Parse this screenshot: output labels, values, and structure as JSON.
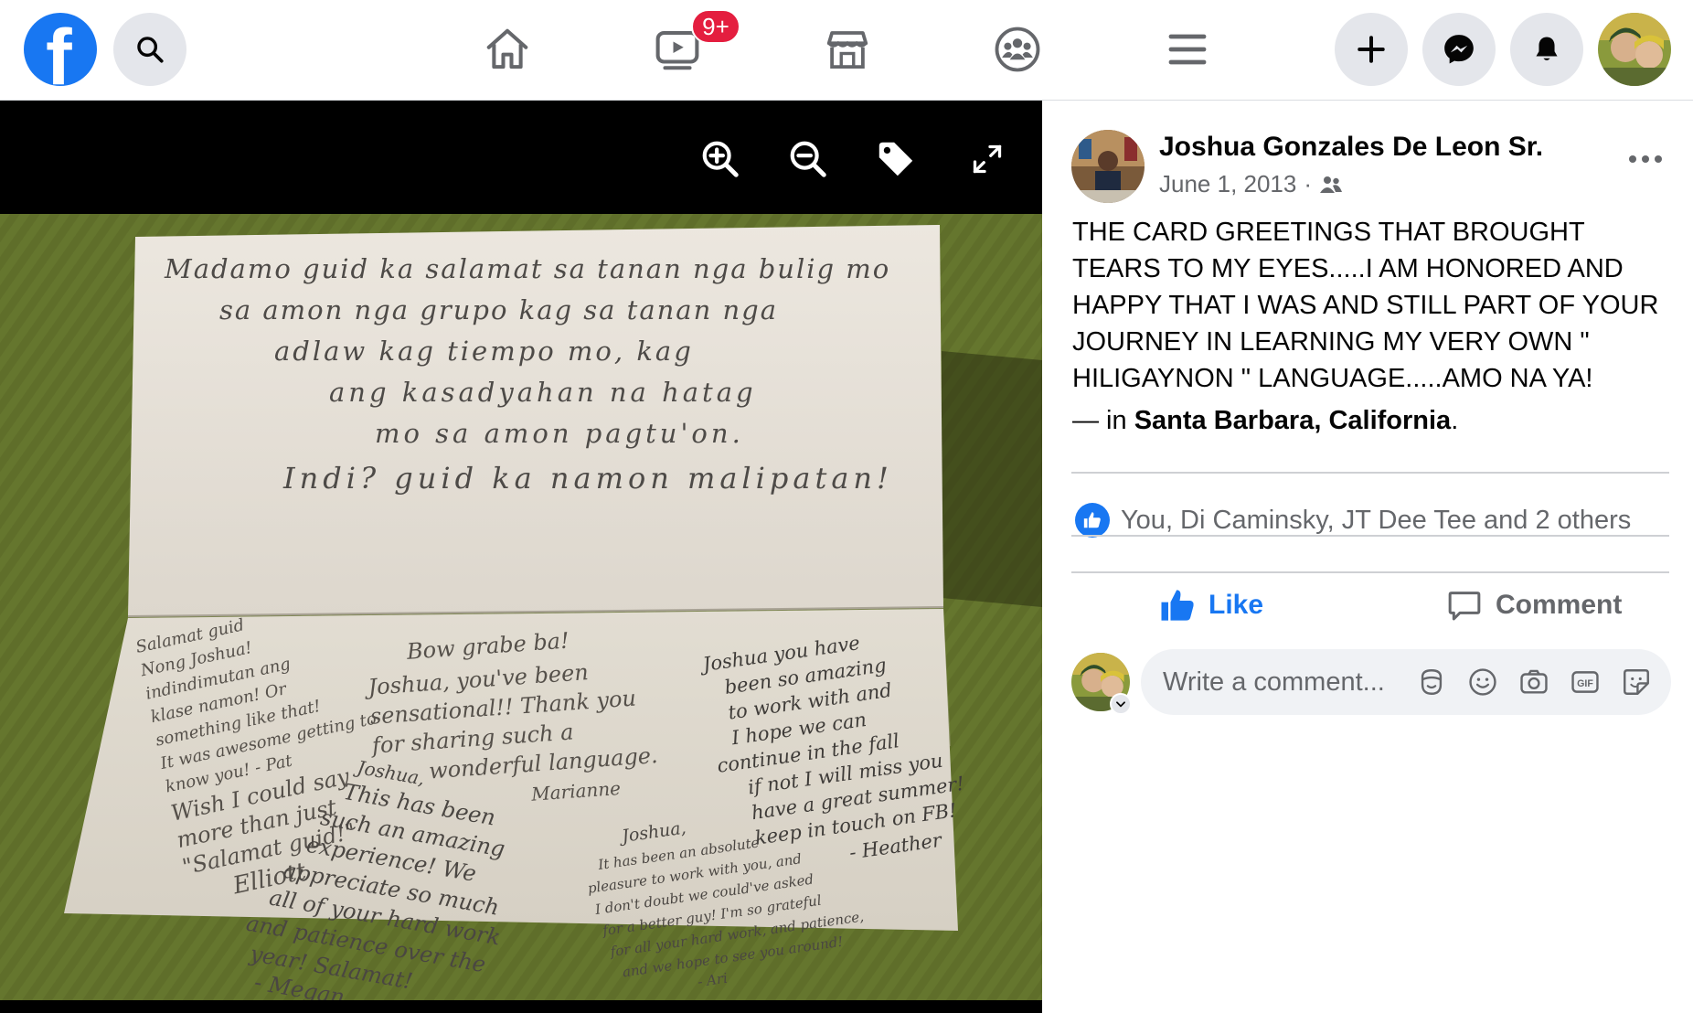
{
  "topbar": {
    "logo_letter": "f",
    "icons": {
      "search": "search-icon",
      "home": "home-icon",
      "watch": "video-icon",
      "marketplace": "store-icon",
      "groups": "groups-icon",
      "menu": "hamburger-icon",
      "create": "plus-icon",
      "messenger": "messenger-icon",
      "notifications": "bell-icon"
    },
    "watch_badge": "9+"
  },
  "photo": {
    "toolbar_icons": [
      "zoom-in-icon",
      "zoom-out-icon",
      "tag-icon",
      "fullscreen-icon"
    ],
    "card_top_lines": [
      "Madamo guid ka salamat sa tanan nga bulig mo",
      "sa amon nga grupo kag sa tanan nga",
      "adlaw kag tiempo mo, kag",
      "ang kasadyahan na hatag",
      "mo sa amon pagtu'on.",
      "Indi? guid ka namon malipatan!"
    ],
    "note_1": [
      "Salamat guid",
      "Nong Joshua!",
      "indindimutan ang",
      "klase namon! Or",
      "something like that!",
      "It was awesome getting to",
      "know you! - Pat",
      "Wish I could say",
      "more than just",
      "\"Salamat guid!\"",
      "Elliott"
    ],
    "note_2": [
      "Bow grabe ba!",
      "Joshua, you've been",
      "sensational!! Thank you",
      "for sharing such a",
      "wonderful language.",
      "Marianne"
    ],
    "note_3": [
      "Joshua you have",
      "been so amazing",
      "to work with and",
      "I hope we can",
      "continue in the fall",
      "if not I will miss you",
      "have a great summer!",
      "keep in touch on FB!",
      "- Heather"
    ],
    "note_4": [
      "Joshua,",
      "This has been",
      "such an amazing",
      "experience! We",
      "appreciate so much",
      "all of your hard work",
      "and patience over the",
      "year! Salamat!",
      "- Megan"
    ],
    "note_5": [
      "Joshua,",
      "It has been an absolute",
      "pleasure to work with you, and",
      "I don't doubt we could've asked",
      "for a better guy! I'm so grateful",
      "for all your hard work, and patience,",
      "and we hope to see you around!",
      "- Ari"
    ]
  },
  "post": {
    "author": "Joshua Gonzales De Leon Sr.",
    "date": "June 1, 2013",
    "meta_separator": "·",
    "audience_icon": "friends-icon",
    "more_icon": "more-dots-icon",
    "text": "THE CARD GREETINGS THAT BROUGHT TEARS TO MY EYES.....I AM HONORED AND HAPPY THAT I WAS AND STILL PART OF YOUR JOURNEY IN LEARNING MY VERY OWN \" HILIGAYNON \" LANGUAGE.....AMO NA YA!",
    "location_prefix": "— in ",
    "location": "Santa Barbara, California",
    "location_suffix": ".",
    "reactions_text": "You, Di Caminsky, JT Dee Tee and 2 others",
    "like_label": "Like",
    "comment_label": "Comment",
    "comment_placeholder": "Write a comment...",
    "comment_icons": [
      "avatar-sticker-icon",
      "emoji-icon",
      "camera-icon",
      "gif-icon",
      "sticker-icon"
    ]
  },
  "colors": {
    "brand": "#1877f2",
    "badge": "#e41e3f",
    "secondary_text": "#65676b",
    "button_bg": "#e4e6eb",
    "comment_bg": "#f0f2f5"
  }
}
